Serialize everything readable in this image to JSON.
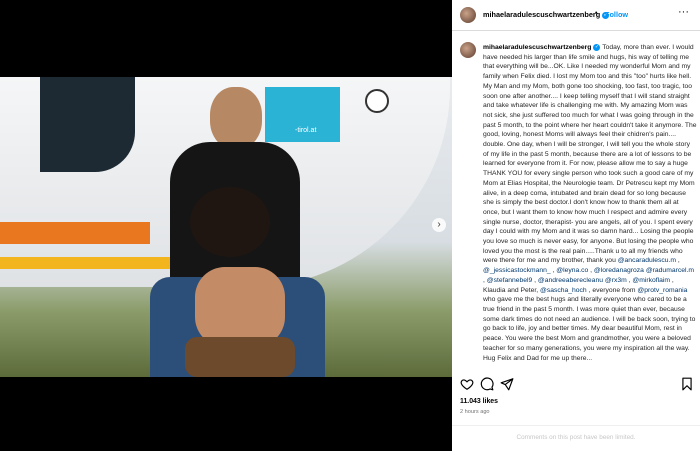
{
  "post": {
    "username": "mihaelaradulescuschwartzenberg",
    "separator": "•",
    "follow_label": "Follow",
    "more_label": "···",
    "caption_author": "mihaelaradulescuschwartzenberg",
    "caption_parts": [
      {
        "t": "text",
        "v": "Today, more than ever. I would have needed his larger than life smile and hugs, his way of telling me that everything will be...OK. Like I needed my wonderful Mom and my family when Felix died. I lost my Mom too and this \"too\" hurts like hell. My Man and my Mom, both gone too shocking, too fast, too tragic, too soon one after another.... I keep telling myself that I will stand straight and take whatever life is challenging me with. My amazing Mom was not sick, she just suffered too much for what I was going through in the past 5 month, to the point where her heart couldn't take it anymore. The good, loving, honest Moms will always feel their chidren's pain.... double. One day, when I will be stronger, I will tell you the whole story of my life in the past 5 month, because there are a lot of lessons to be learned for everyone from it. For now, please allow me to say a huge THANK YOU for every single person who took such a good care of my Mom at Elias Hospital, the Neurologie team. Dr Petrescu kept my Mom alive, in a deep coma, intubated and brain dead for so long because she is simply the best doctor.I don't know how to thank them all at once, but I want them to know how much I respect and admire every single nurse, doctor, therapist- you are angels, all of you. I spent every day I could with my Mom and it was so damn hard... Losing the people you love so much is never easy, for anyone. But losing the people who loved you the most is the real pain.....Thank u to all my friends who were there for me and my brother, thank you "
      },
      {
        "t": "mention",
        "v": "@ancaradulescu.m"
      },
      {
        "t": "text",
        "v": " , "
      },
      {
        "t": "mention",
        "v": "@_jessicastockmann_"
      },
      {
        "t": "text",
        "v": " , "
      },
      {
        "t": "mention",
        "v": "@leyna.co"
      },
      {
        "t": "text",
        "v": " , "
      },
      {
        "t": "mention",
        "v": "@loredanagroza"
      },
      {
        "t": "text",
        "v": " "
      },
      {
        "t": "mention",
        "v": "@radumarcel.m"
      },
      {
        "t": "text",
        "v": " , "
      },
      {
        "t": "mention",
        "v": "@stefannebel9"
      },
      {
        "t": "text",
        "v": " , "
      },
      {
        "t": "mention",
        "v": "@andreeaberecleanu"
      },
      {
        "t": "text",
        "v": " "
      },
      {
        "t": "mention",
        "v": "@rx3m"
      },
      {
        "t": "text",
        "v": " , "
      },
      {
        "t": "mention",
        "v": "@mirkoflaim"
      },
      {
        "t": "text",
        "v": " , Klaudia and Peter, "
      },
      {
        "t": "mention",
        "v": "@sascha_hoch"
      },
      {
        "t": "text",
        "v": " , everyone from "
      },
      {
        "t": "mention",
        "v": "@protv_romania"
      },
      {
        "t": "text",
        "v": " who gave me the best hugs and literally everyone who cared to be a true friend in the past 5 month. I was more quiet than ever, because some dark times do not need an audience. I will be back soon, trying to go back to life, joy and better times. My dear beautiful Mom, rest in peace. You were the best Mom and grandmother, you were a beloved teacher for so many generations, you were my inspiration all the way. Hug Felix and Dad for me up there..."
      }
    ],
    "likes": "11.043 likes",
    "time_ago": "2 hours ago",
    "comments_limited": "Comments on this post have been limited."
  },
  "media": {
    "next_arrow": "›",
    "helicopter_badge_text": "-tirol.at"
  },
  "icons": [
    "heart-icon",
    "comment-icon",
    "share-icon",
    "save-icon",
    "verified-icon",
    "more-options-icon",
    "next-arrow-icon"
  ]
}
